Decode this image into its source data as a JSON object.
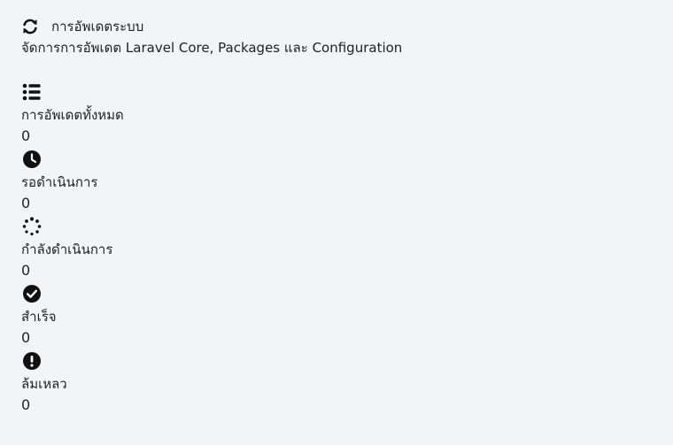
{
  "header": {
    "title": "การอัพเดตระบบ",
    "subtitle": "จัดการการอัพเดต Laravel Core, Packages และ Configuration",
    "icon": "sync-icon"
  },
  "stats": [
    {
      "icon": "list-icon",
      "label": "การอัพเดตทั้งหมด",
      "value": "0"
    },
    {
      "icon": "clock-icon",
      "label": "รอดำเนินการ",
      "value": "0"
    },
    {
      "icon": "spinner-icon",
      "label": "กำลังดำเนินการ",
      "value": "0"
    },
    {
      "icon": "check-circle-icon",
      "label": "สำเร็จ",
      "value": "0"
    },
    {
      "icon": "exclamation-circle-icon",
      "label": "ล้มเหลว",
      "value": "0"
    }
  ]
}
